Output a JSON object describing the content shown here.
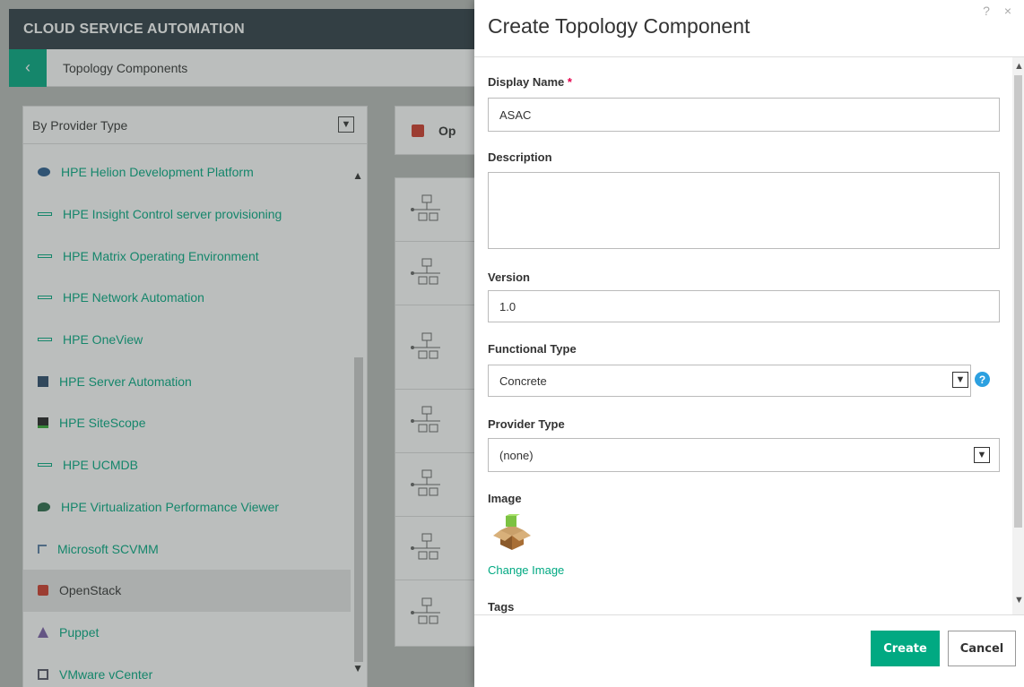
{
  "app": {
    "title": "CLOUD SERVICE AUTOMATION"
  },
  "subnav": {
    "back_glyph": "‹",
    "title": "Topology Components"
  },
  "filter": {
    "value": "By Provider Type"
  },
  "providers": [
    {
      "label": "HPE Helion Development Platform",
      "icon": "helion-icon"
    },
    {
      "label": "HPE Insight Control server provisioning",
      "icon": "server-bar-icon"
    },
    {
      "label": "HPE Matrix Operating Environment",
      "icon": "server-bar-icon"
    },
    {
      "label": "HPE Network Automation",
      "icon": "server-bar-icon"
    },
    {
      "label": "HPE OneView",
      "icon": "server-bar-icon"
    },
    {
      "label": "HPE Server Automation",
      "icon": "server-automation-icon"
    },
    {
      "label": "HPE SiteScope",
      "icon": "sitescope-icon"
    },
    {
      "label": "HPE UCMDB",
      "icon": "server-bar-icon"
    },
    {
      "label": "HPE Virtualization Performance Viewer",
      "icon": "virtualization-icon"
    },
    {
      "label": "Microsoft SCVMM",
      "icon": "scvmm-icon"
    },
    {
      "label": "OpenStack",
      "icon": "openstack-icon",
      "selected": true
    },
    {
      "label": "Puppet",
      "icon": "puppet-icon"
    },
    {
      "label": "VMware vCenter",
      "icon": "vcenter-icon"
    }
  ],
  "mid": {
    "header_trunc": "Op"
  },
  "modal": {
    "title": "Create Topology Component",
    "controls": "? ×",
    "display_name_label": "Display Name",
    "required_mark": "*",
    "display_name_value": "ASAC",
    "description_label": "Description",
    "description_value": "",
    "version_label": "Version",
    "version_value": "1.0",
    "functional_type_label": "Functional Type",
    "functional_type_value": "Concrete",
    "help_glyph": "?",
    "provider_type_label": "Provider Type",
    "provider_type_value": "(none)",
    "image_label": "Image",
    "change_image_label": "Change Image",
    "tags_label": "Tags",
    "create_label": "Create",
    "cancel_label": "Cancel"
  },
  "colors": {
    "accent": "#01a982",
    "header_bg": "#2e3d45",
    "required": "#e5004c",
    "help": "#2ca0e0"
  }
}
